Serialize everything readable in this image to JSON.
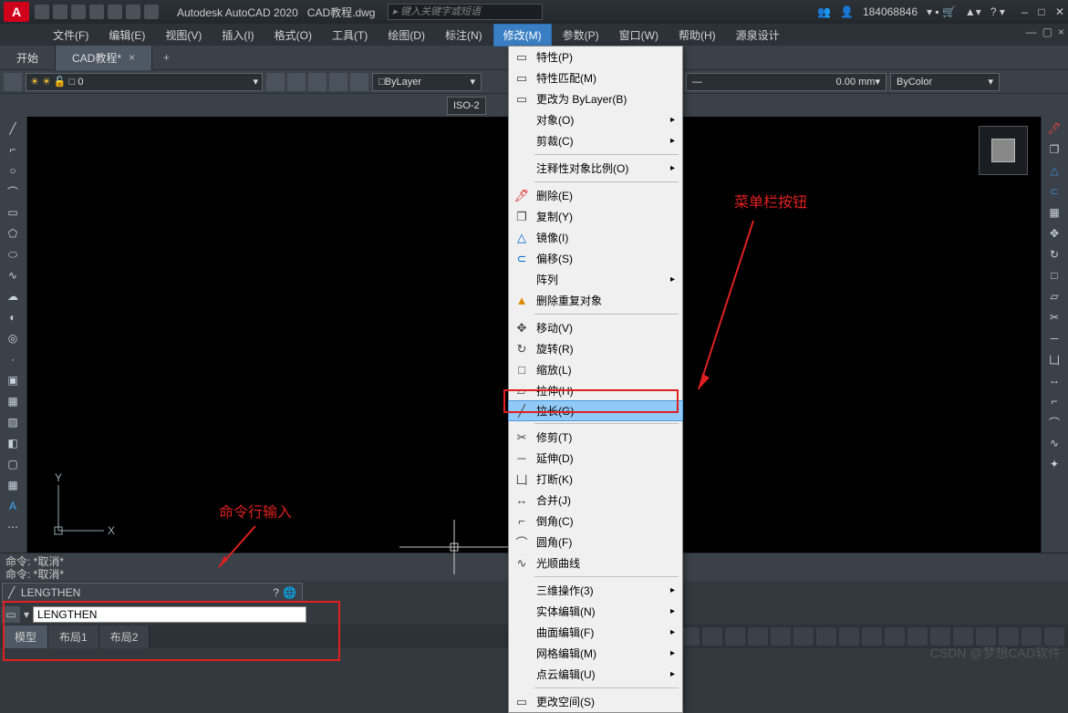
{
  "titlebar": {
    "app_name": "Autodesk AutoCAD 2020",
    "document": "CAD教程.dwg",
    "search_placeholder": "键入关键字或短语",
    "user": "184068846",
    "logo_letter": "A"
  },
  "menubar": [
    "文件(F)",
    "编辑(E)",
    "视图(V)",
    "插入(I)",
    "格式(O)",
    "工具(T)",
    "绘图(D)",
    "标注(N)",
    "修改(M)",
    "参数(P)",
    "窗口(W)",
    "帮助(H)",
    "源泉设计"
  ],
  "open_menu_index": 8,
  "tabs": [
    {
      "label": "开始",
      "active": false
    },
    {
      "label": "CAD教程*",
      "active": true
    }
  ],
  "layer": {
    "name": "0"
  },
  "props": {
    "linetype": "ByLayer",
    "lineweight": "0.00 mm",
    "color": "ByColor"
  },
  "dim_style": "ISO-2",
  "dropdown_menu": {
    "sections": [
      [
        {
          "label": "特性(P)",
          "icon": "▭"
        },
        {
          "label": "特性匹配(M)",
          "icon": "▭"
        },
        {
          "label": "更改为 ByLayer(B)",
          "icon": "▭"
        },
        {
          "label": "对象(O)",
          "sub": true
        },
        {
          "label": "剪裁(C)",
          "sub": true
        }
      ],
      [
        {
          "label": "注释性对象比例(O)",
          "sub": true
        }
      ],
      [
        {
          "label": "删除(E)",
          "icon": "🖊",
          "c": "#d22"
        },
        {
          "label": "复制(Y)",
          "icon": "❐"
        },
        {
          "label": "镜像(I)",
          "icon": "△",
          "c": "#06c"
        },
        {
          "label": "偏移(S)",
          "icon": "⊂",
          "c": "#06c"
        },
        {
          "label": "阵列",
          "sub": true
        },
        {
          "label": "删除重复对象",
          "icon": "▲",
          "c": "#d80"
        }
      ],
      [
        {
          "label": "移动(V)",
          "icon": "✥"
        },
        {
          "label": "旋转(R)",
          "icon": "↻"
        },
        {
          "label": "缩放(L)",
          "icon": "□"
        },
        {
          "label": "拉伸(H)",
          "icon": "▱"
        },
        {
          "label": "拉长(G)",
          "icon": "╱",
          "highlight": true
        }
      ],
      [
        {
          "label": "修剪(T)",
          "icon": "✂"
        },
        {
          "label": "延伸(D)",
          "icon": "─"
        },
        {
          "label": "打断(K)",
          "icon": "凵"
        },
        {
          "label": "合并(J)",
          "icon": "↔"
        },
        {
          "label": "倒角(C)",
          "icon": "⌐"
        },
        {
          "label": "圆角(F)",
          "icon": "⌒"
        },
        {
          "label": "光顺曲线",
          "icon": "∿"
        }
      ],
      [
        {
          "label": "三维操作(3)",
          "sub": true
        },
        {
          "label": "实体编辑(N)",
          "sub": true
        },
        {
          "label": "曲面编辑(F)",
          "sub": true
        },
        {
          "label": "网格编辑(M)",
          "sub": true
        },
        {
          "label": "点云编辑(U)",
          "sub": true
        }
      ],
      [
        {
          "label": "更改空间(S)",
          "icon": "▭"
        }
      ]
    ]
  },
  "annotations": {
    "menu_button": "菜单栏按钮",
    "cmd_input": "命令行输入"
  },
  "command": {
    "history": [
      "命令: *取消*",
      "命令: *取消*"
    ],
    "autocomplete_item": "LENGTHEN",
    "input_value": "LENGTHEN"
  },
  "status": {
    "tabs": [
      "模型",
      "布局1",
      "布局2"
    ],
    "active_tab": 0
  },
  "ucs_labels": {
    "x": "X",
    "y": "Y"
  },
  "watermark": "CSDN @梦想CAD软件"
}
